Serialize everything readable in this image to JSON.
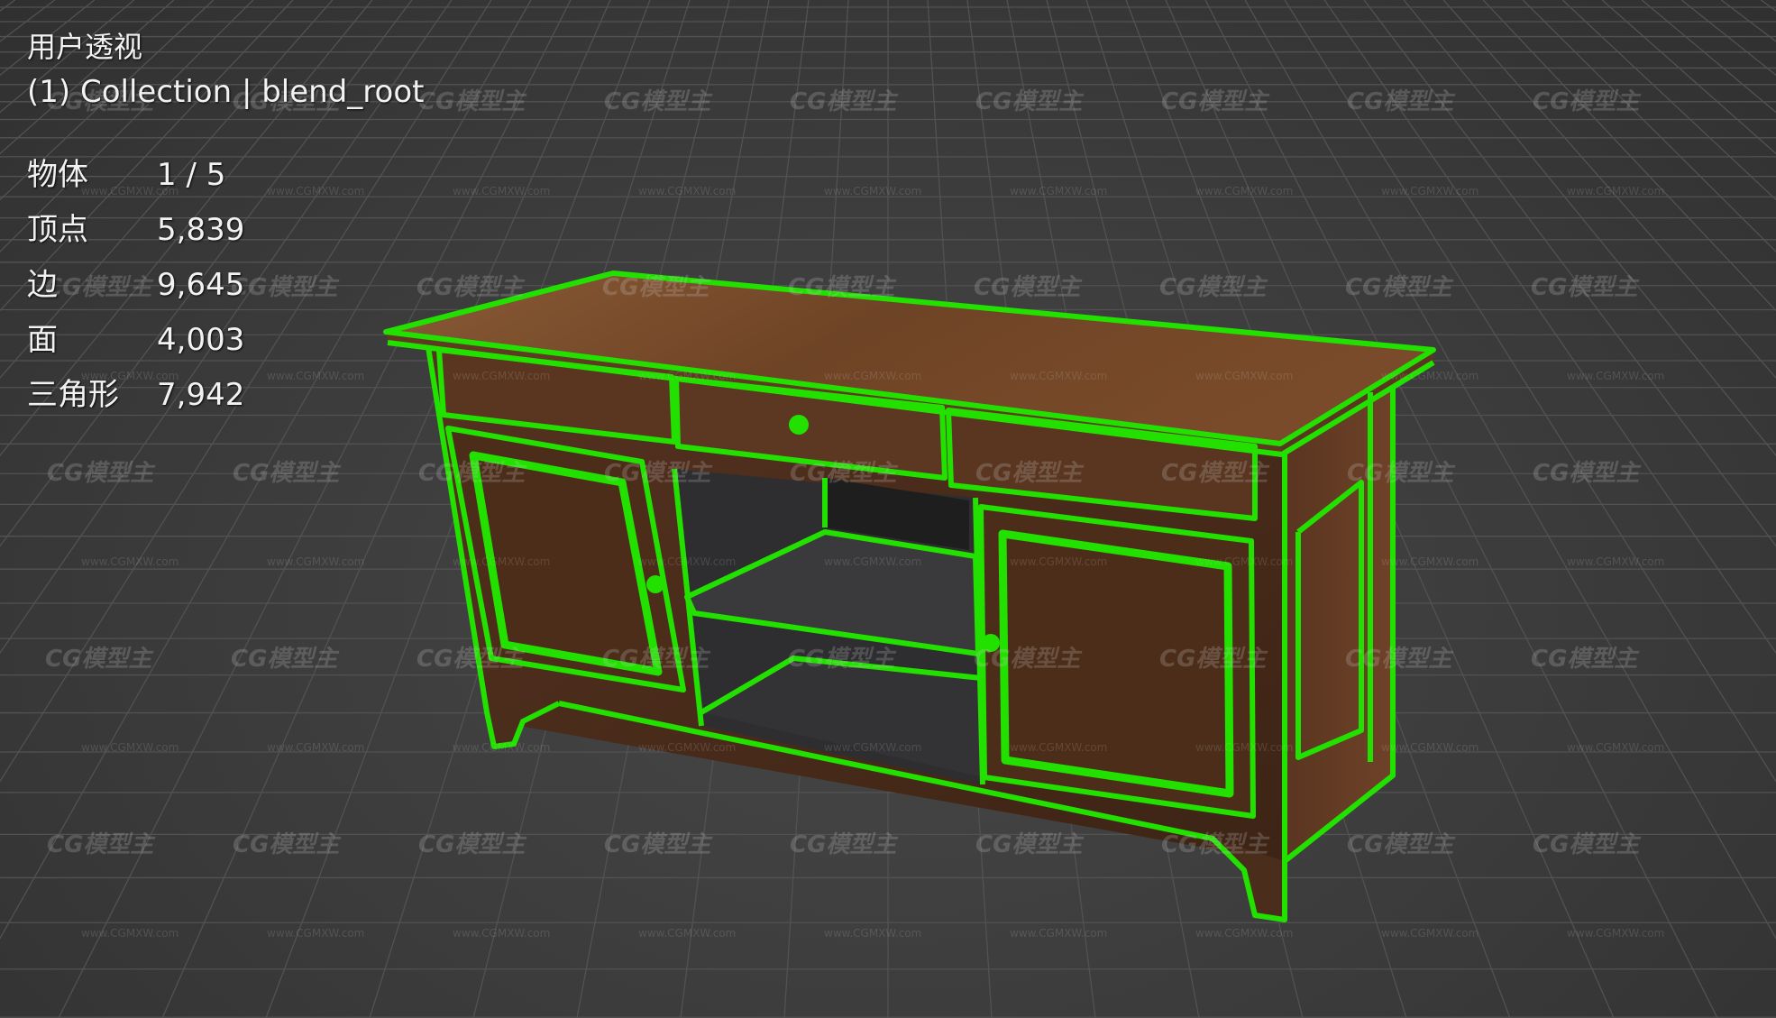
{
  "viewport": {
    "view_name": "用户透视",
    "collection_line": "(1) Collection | blend_root"
  },
  "stats": [
    {
      "label": "物体",
      "value": "1 / 5"
    },
    {
      "label": "顶点",
      "value": "5,839"
    },
    {
      "label": "边",
      "value": "9,645"
    },
    {
      "label": "面",
      "value": "4,003"
    },
    {
      "label": "三角形",
      "value": "7,942"
    }
  ],
  "watermark": {
    "logo": "CG模型主",
    "url": "www.CGMXW.com"
  },
  "colors": {
    "background": "#3a3a3a",
    "grid": "#545454",
    "selection_outline": "#22e000",
    "wood_light": "#7a4f2e",
    "wood_dark": "#4a2c1a",
    "text": "#f2f2f2"
  }
}
